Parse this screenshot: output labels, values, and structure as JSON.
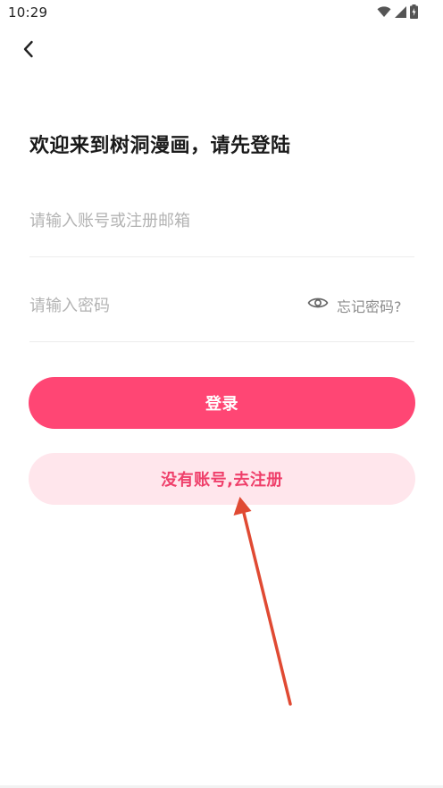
{
  "status_bar": {
    "time": "10:29",
    "icons": [
      "wifi-icon",
      "signal-icon",
      "battery-icon"
    ]
  },
  "header": {
    "back_icon": "chevron-left-icon"
  },
  "main": {
    "title": "欢迎来到树洞漫画，请先登陆",
    "account_field": {
      "value": "",
      "placeholder": "请输入账号或注册邮箱"
    },
    "password_field": {
      "value": "",
      "placeholder": "请输入密码",
      "toggle_icon": "eye-icon",
      "forgot_label": "忘记密码?"
    },
    "login_button": "登录",
    "register_button": "没有账号,去注册"
  },
  "colors": {
    "primary": "#ff4674",
    "secondary_bg": "#ffe6ec",
    "secondary_text": "#ef3f6a",
    "annotation_arrow": "#e04a33"
  }
}
